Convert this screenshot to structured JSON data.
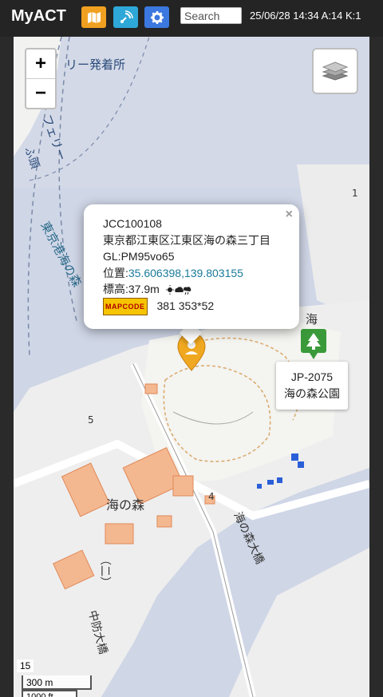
{
  "app": {
    "title": "MyACT"
  },
  "toolbar": {
    "map_button_color": "#f0a020",
    "signal_button_color": "#2ea8d8",
    "settings_button_color": "#3b78e0",
    "search_placeholder": "Search",
    "status": "25/06/28 14:34 A:14 K:1"
  },
  "map": {
    "zoom_in": "+",
    "zoom_out": "−",
    "labels": {
      "ferry_terminal": "リー発着所",
      "ferry_route": "フェリー",
      "ferry_route2": "ふ頭",
      "canal_name": "東京港海の森",
      "district_label": "海",
      "road_label": "海の森大橋",
      "area_label": "海の森",
      "area_label2": "（二）",
      "bridge_label": "中防大橋",
      "block_num": "5",
      "block_num2": "4",
      "block_num3": "1"
    },
    "popup": {
      "code": "JCC100108",
      "address": "東京都江東区江東区海の森三丁目",
      "grid": "GL:PM95vo65",
      "position_label": "位置:",
      "position_value": "35.606398,139.803155",
      "elevation": "標高:37.9m",
      "weather_icon": "sun-cloud-rain",
      "mapcode_badge": "MAPCODE",
      "mapcode_value": "381 353*52",
      "close": "×"
    },
    "park_marker": {
      "ref": "JP-2075",
      "name": "海の森公園",
      "color": "#3a9a3a"
    },
    "location_marker_color": "#f0a820",
    "zoom_level": "15",
    "scale_label": "300 m",
    "scale_label2": "1000 ft"
  }
}
